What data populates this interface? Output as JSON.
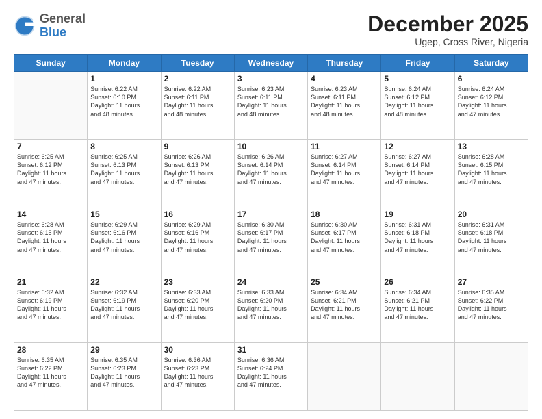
{
  "header": {
    "logo_general": "General",
    "logo_blue": "Blue",
    "month_title": "December 2025",
    "subtitle": "Ugep, Cross River, Nigeria"
  },
  "calendar": {
    "days_of_week": [
      "Sunday",
      "Monday",
      "Tuesday",
      "Wednesday",
      "Thursday",
      "Friday",
      "Saturday"
    ],
    "weeks": [
      [
        {
          "day": "",
          "info": ""
        },
        {
          "day": "1",
          "info": "Sunrise: 6:22 AM\nSunset: 6:10 PM\nDaylight: 11 hours\nand 48 minutes."
        },
        {
          "day": "2",
          "info": "Sunrise: 6:22 AM\nSunset: 6:11 PM\nDaylight: 11 hours\nand 48 minutes."
        },
        {
          "day": "3",
          "info": "Sunrise: 6:23 AM\nSunset: 6:11 PM\nDaylight: 11 hours\nand 48 minutes."
        },
        {
          "day": "4",
          "info": "Sunrise: 6:23 AM\nSunset: 6:11 PM\nDaylight: 11 hours\nand 48 minutes."
        },
        {
          "day": "5",
          "info": "Sunrise: 6:24 AM\nSunset: 6:12 PM\nDaylight: 11 hours\nand 48 minutes."
        },
        {
          "day": "6",
          "info": "Sunrise: 6:24 AM\nSunset: 6:12 PM\nDaylight: 11 hours\nand 47 minutes."
        }
      ],
      [
        {
          "day": "7",
          "info": "Sunrise: 6:25 AM\nSunset: 6:12 PM\nDaylight: 11 hours\nand 47 minutes."
        },
        {
          "day": "8",
          "info": "Sunrise: 6:25 AM\nSunset: 6:13 PM\nDaylight: 11 hours\nand 47 minutes."
        },
        {
          "day": "9",
          "info": "Sunrise: 6:26 AM\nSunset: 6:13 PM\nDaylight: 11 hours\nand 47 minutes."
        },
        {
          "day": "10",
          "info": "Sunrise: 6:26 AM\nSunset: 6:14 PM\nDaylight: 11 hours\nand 47 minutes."
        },
        {
          "day": "11",
          "info": "Sunrise: 6:27 AM\nSunset: 6:14 PM\nDaylight: 11 hours\nand 47 minutes."
        },
        {
          "day": "12",
          "info": "Sunrise: 6:27 AM\nSunset: 6:14 PM\nDaylight: 11 hours\nand 47 minutes."
        },
        {
          "day": "13",
          "info": "Sunrise: 6:28 AM\nSunset: 6:15 PM\nDaylight: 11 hours\nand 47 minutes."
        }
      ],
      [
        {
          "day": "14",
          "info": "Sunrise: 6:28 AM\nSunset: 6:15 PM\nDaylight: 11 hours\nand 47 minutes."
        },
        {
          "day": "15",
          "info": "Sunrise: 6:29 AM\nSunset: 6:16 PM\nDaylight: 11 hours\nand 47 minutes."
        },
        {
          "day": "16",
          "info": "Sunrise: 6:29 AM\nSunset: 6:16 PM\nDaylight: 11 hours\nand 47 minutes."
        },
        {
          "day": "17",
          "info": "Sunrise: 6:30 AM\nSunset: 6:17 PM\nDaylight: 11 hours\nand 47 minutes."
        },
        {
          "day": "18",
          "info": "Sunrise: 6:30 AM\nSunset: 6:17 PM\nDaylight: 11 hours\nand 47 minutes."
        },
        {
          "day": "19",
          "info": "Sunrise: 6:31 AM\nSunset: 6:18 PM\nDaylight: 11 hours\nand 47 minutes."
        },
        {
          "day": "20",
          "info": "Sunrise: 6:31 AM\nSunset: 6:18 PM\nDaylight: 11 hours\nand 47 minutes."
        }
      ],
      [
        {
          "day": "21",
          "info": "Sunrise: 6:32 AM\nSunset: 6:19 PM\nDaylight: 11 hours\nand 47 minutes."
        },
        {
          "day": "22",
          "info": "Sunrise: 6:32 AM\nSunset: 6:19 PM\nDaylight: 11 hours\nand 47 minutes."
        },
        {
          "day": "23",
          "info": "Sunrise: 6:33 AM\nSunset: 6:20 PM\nDaylight: 11 hours\nand 47 minutes."
        },
        {
          "day": "24",
          "info": "Sunrise: 6:33 AM\nSunset: 6:20 PM\nDaylight: 11 hours\nand 47 minutes."
        },
        {
          "day": "25",
          "info": "Sunrise: 6:34 AM\nSunset: 6:21 PM\nDaylight: 11 hours\nand 47 minutes."
        },
        {
          "day": "26",
          "info": "Sunrise: 6:34 AM\nSunset: 6:21 PM\nDaylight: 11 hours\nand 47 minutes."
        },
        {
          "day": "27",
          "info": "Sunrise: 6:35 AM\nSunset: 6:22 PM\nDaylight: 11 hours\nand 47 minutes."
        }
      ],
      [
        {
          "day": "28",
          "info": "Sunrise: 6:35 AM\nSunset: 6:22 PM\nDaylight: 11 hours\nand 47 minutes."
        },
        {
          "day": "29",
          "info": "Sunrise: 6:35 AM\nSunset: 6:23 PM\nDaylight: 11 hours\nand 47 minutes."
        },
        {
          "day": "30",
          "info": "Sunrise: 6:36 AM\nSunset: 6:23 PM\nDaylight: 11 hours\nand 47 minutes."
        },
        {
          "day": "31",
          "info": "Sunrise: 6:36 AM\nSunset: 6:24 PM\nDaylight: 11 hours\nand 47 minutes."
        },
        {
          "day": "",
          "info": ""
        },
        {
          "day": "",
          "info": ""
        },
        {
          "day": "",
          "info": ""
        }
      ]
    ]
  }
}
